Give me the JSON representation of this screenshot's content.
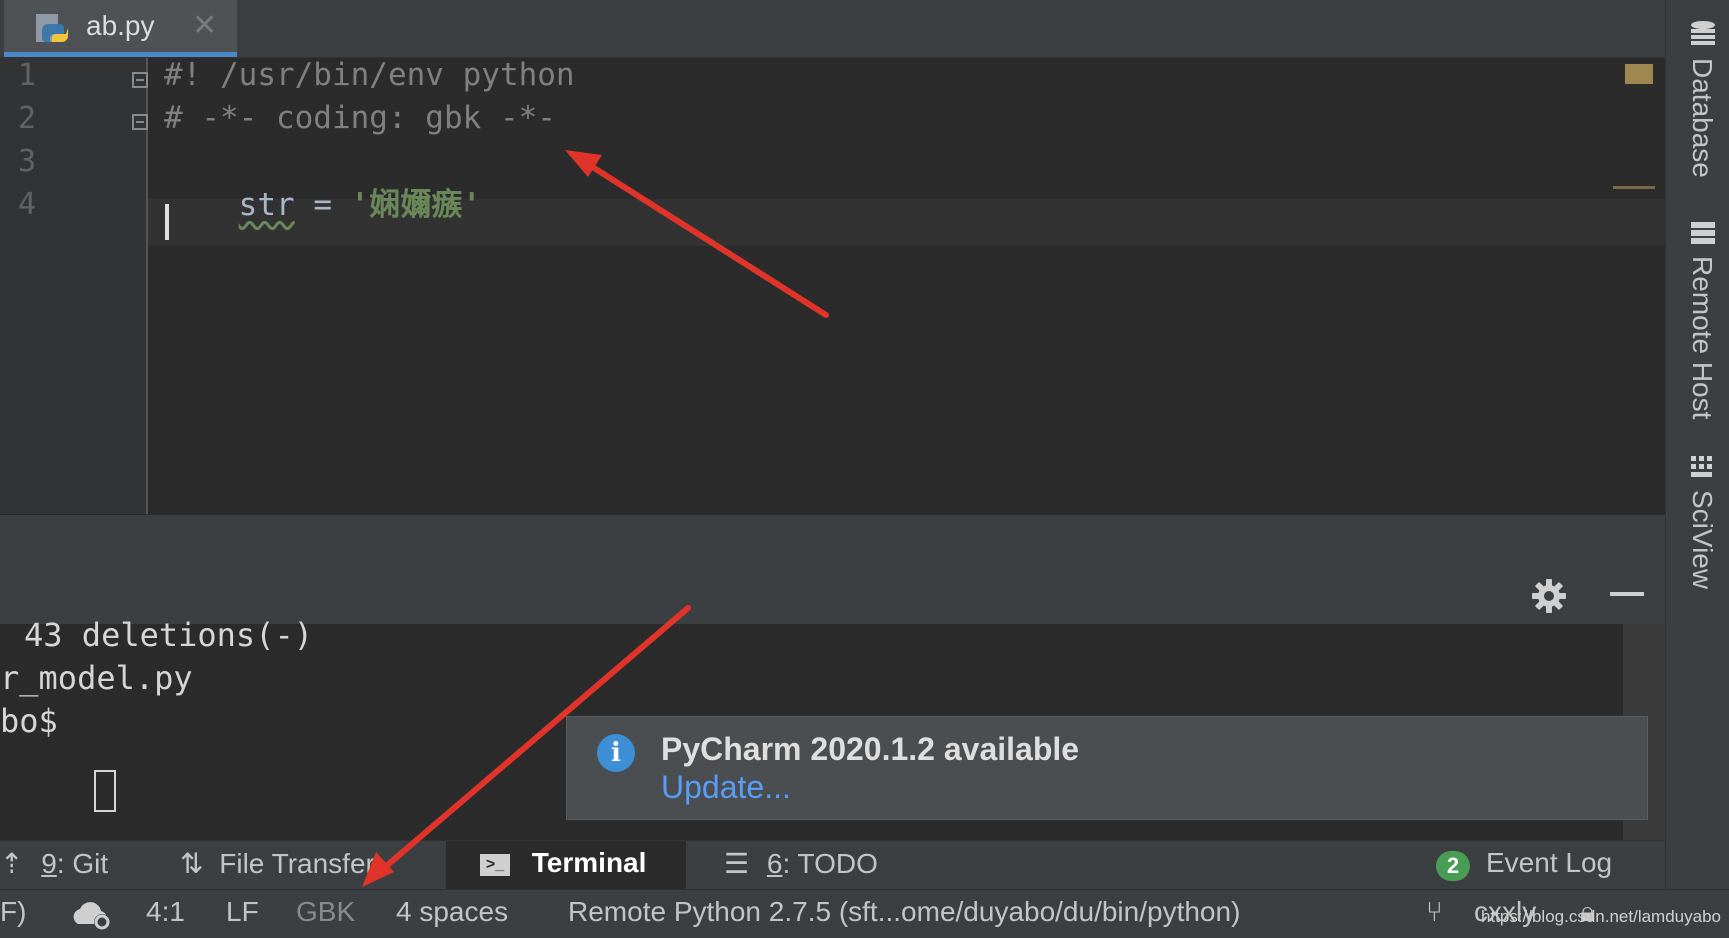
{
  "tab": {
    "filename": "ab.py",
    "close_symbol": "✕",
    "icon": "python-file-icon"
  },
  "editor": {
    "line_numbers": [
      "1",
      "2",
      "3",
      "4"
    ],
    "lines": {
      "l1": "#! /usr/bin/env python",
      "l2": "# -*- coding: gbk -*-",
      "l3_ident": "str",
      "l3_op": " = ",
      "l3_string": "'娴嬭瘯'"
    }
  },
  "terminal": {
    "lines": [
      "43 deletions(-)",
      "r_model.py",
      "bo$ "
    ]
  },
  "notification": {
    "icon_text": "i",
    "title": "PyCharm 2020.1.2 available",
    "link": "Update..."
  },
  "tool_windows": {
    "git": {
      "key": "9",
      "label": ": Git"
    },
    "file_transfer": {
      "label": "File Transfer"
    },
    "terminal": {
      "label": "Terminal"
    },
    "todo": {
      "key": "6",
      "label": ": TODO"
    },
    "event_log": {
      "badge": "2",
      "label": "Event Log"
    }
  },
  "status_bar": {
    "left_fragment": "F)",
    "position": "4:1",
    "line_separator": "LF",
    "encoding": "GBK",
    "indent": "4 spaces",
    "interpreter": "Remote Python 2.7.5 (sft...ome/duyabo/du/bin/python)",
    "branch": "cxxly",
    "watermark": "https://blog.csdn.net/lamduyabo"
  },
  "right_sidebar": [
    "Database",
    "Remote Host",
    "SciView"
  ],
  "colors": {
    "editor_bg": "#2b2b2b",
    "panel_bg": "#3c3f41",
    "comment": "#808080",
    "string": "#6a8759",
    "accent_blue": "#4a88c7",
    "annotation_arrow": "#e0342a"
  }
}
